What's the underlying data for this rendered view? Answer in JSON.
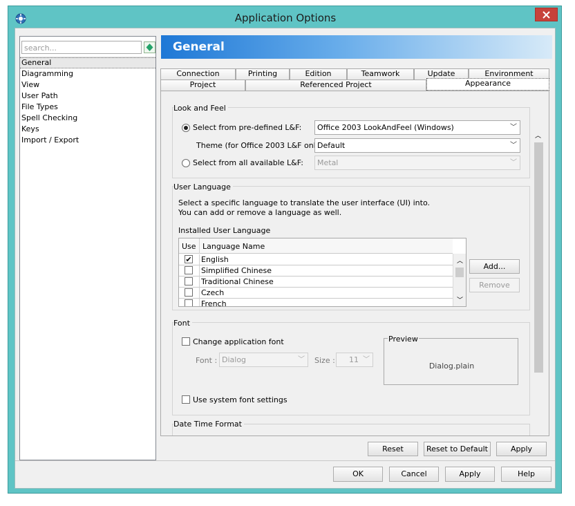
{
  "window": {
    "title": "Application Options"
  },
  "colors": {
    "banner_start": "#1e78d6",
    "banner_end": "#d7eaf8",
    "titlebar": "#5fc4c5",
    "close_button": "#c7423a"
  },
  "sidebar": {
    "search_placeholder": "search...",
    "items": [
      {
        "label": "General",
        "selected": true
      },
      {
        "label": "Diagramming"
      },
      {
        "label": "View"
      },
      {
        "label": "User Path"
      },
      {
        "label": "File Types"
      },
      {
        "label": "Spell Checking"
      },
      {
        "label": "Keys"
      },
      {
        "label": "Import / Export"
      }
    ]
  },
  "header": {
    "title": "General"
  },
  "tabs": {
    "row1": [
      "Connection",
      "Printing",
      "Edition",
      "Teamwork",
      "Update",
      "Environment"
    ],
    "row2": [
      "Project",
      "Referenced Project",
      "Appearance"
    ],
    "selected": "Appearance"
  },
  "look_feel": {
    "group_title": "Look and Feel",
    "radio_predefined": "Select from pre-defined L&F:",
    "predefined_value": "Office 2003 LookAndFeel (Windows)",
    "theme_label": "Theme (for Office 2003 L&F only) :",
    "theme_value": "Default",
    "radio_all": "Select from all available L&F:",
    "all_value": "Metal"
  },
  "user_language": {
    "group_title": "User Language",
    "desc1": "Select a specific language to translate the user interface (UI) into.",
    "desc2": "You can add or remove a language as well.",
    "installed_label": "Installed User Language",
    "col_use": "Use",
    "col_name": "Language Name",
    "languages": [
      {
        "name": "English",
        "checked": true
      },
      {
        "name": "Simplified Chinese",
        "checked": false
      },
      {
        "name": "Traditional Chinese",
        "checked": false
      },
      {
        "name": "Czech",
        "checked": false
      },
      {
        "name": "French",
        "checked": false
      }
    ],
    "add_button": "Add...",
    "remove_button": "Remove"
  },
  "font": {
    "group_title": "Font",
    "change_label": "Change application font",
    "font_label": "Font :",
    "font_value": "Dialog",
    "size_label": "Size :",
    "size_value": "11",
    "preview_title": "Preview",
    "preview_text": "Dialog.plain",
    "system_label": "Use system font settings"
  },
  "date_time": {
    "group_title": "Date Time Format"
  },
  "panel_buttons": {
    "reset": "Reset",
    "reset_default": "Reset to Default",
    "apply": "Apply"
  },
  "dialog_buttons": {
    "ok": "OK",
    "cancel": "Cancel",
    "apply": "Apply",
    "help": "Help"
  }
}
